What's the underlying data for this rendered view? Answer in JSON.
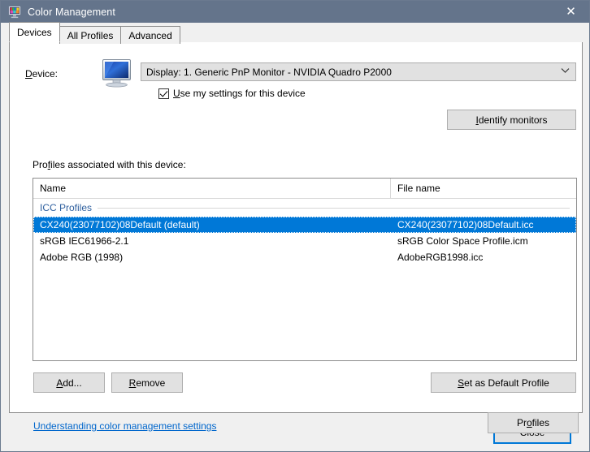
{
  "window": {
    "title": "Color Management",
    "icon": "color-monitor-icon",
    "close_label": "✕",
    "titlebar_color": "#64748b"
  },
  "tabs": [
    {
      "label": "Devices",
      "active": true
    },
    {
      "label": "All Profiles",
      "active": false
    },
    {
      "label": "Advanced",
      "active": false
    }
  ],
  "device": {
    "label": "Device:",
    "label_accel_index": 0,
    "icon": "display-monitor-icon",
    "selected": "Display: 1. Generic PnP Monitor - NVIDIA Quadro P2000",
    "chevron": "˅",
    "options": [
      "Display: 1. Generic PnP Monitor - NVIDIA Quadro P2000"
    ],
    "use_my_settings": {
      "label": "Use my settings for this device",
      "checked": true
    },
    "identify_button": "Identify monitors"
  },
  "profiles": {
    "caption": "Profiles associated with this device:",
    "columns": [
      "Name",
      "File name"
    ],
    "groups": [
      {
        "title": "ICC Profiles",
        "title_color": "#2e5f9e",
        "rows": [
          {
            "name": "CX240(23077102)08Default (default)",
            "file": "CX240(23077102)08Default.icc",
            "selected": true
          },
          {
            "name": "sRGB IEC61966-2.1",
            "file": "sRGB Color Space Profile.icm",
            "selected": false
          },
          {
            "name": "Adobe RGB (1998)",
            "file": "AdobeRGB1998.icc",
            "selected": false
          }
        ]
      }
    ],
    "add_button": "Add...",
    "remove_button": "Remove",
    "set_default_button": "Set as Default Profile"
  },
  "footer": {
    "help_link": "Understanding color management settings",
    "profiles_button": "Profiles",
    "close_button": "Close"
  },
  "colors": {
    "selection_blue": "#0078d7",
    "link_blue": "#0066cc",
    "titlebar": "#64748b",
    "dialog_face": "#f0f0f0"
  }
}
